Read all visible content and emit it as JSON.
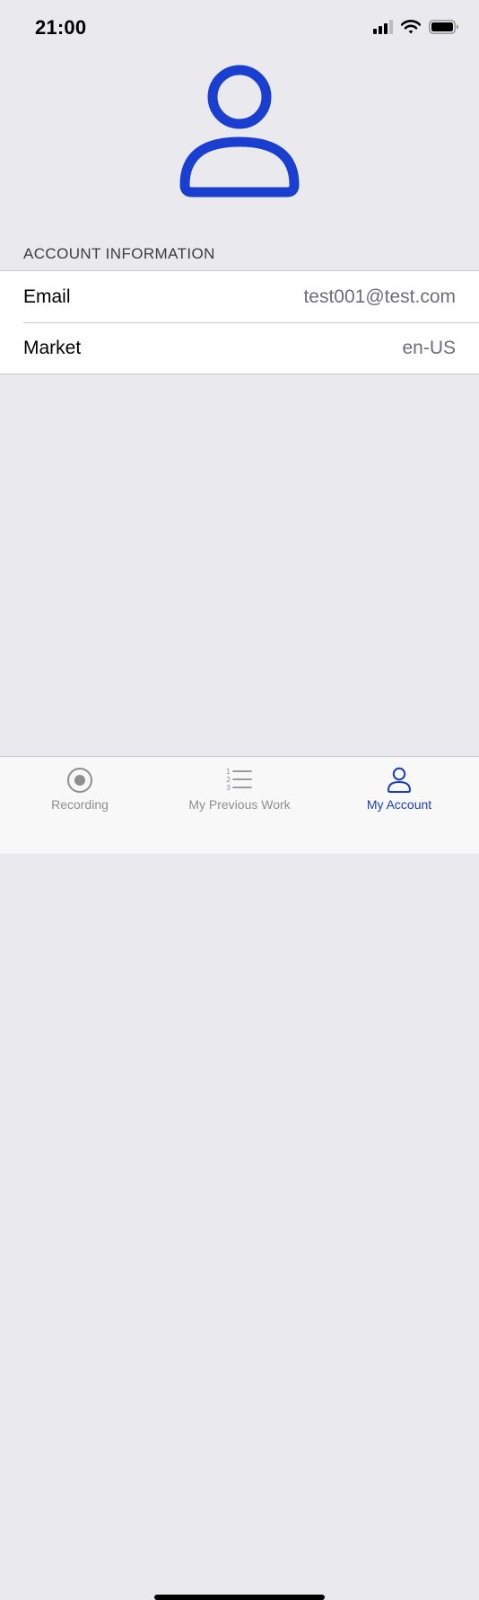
{
  "status_bar": {
    "time": "21:00",
    "icons": [
      "cellular-signal-icon",
      "wifi-icon",
      "battery-icon"
    ]
  },
  "profile": {
    "avatar_icon": "person-icon",
    "accent_color": "#1a3fd0"
  },
  "account_section": {
    "header": "ACCOUNT INFORMATION",
    "rows": [
      {
        "label": "Email",
        "value": "test001@test.com"
      },
      {
        "label": "Market",
        "value": "en-US"
      }
    ]
  },
  "tab_bar": {
    "active_color": "#1a3fb5",
    "inactive_color": "#8e8e93",
    "tabs": [
      {
        "label": "Recording",
        "icon": "record-icon",
        "active": false
      },
      {
        "label": "My Previous Work",
        "icon": "numbered-list-icon",
        "active": false
      },
      {
        "label": "My Account",
        "icon": "person-icon",
        "active": true
      }
    ]
  }
}
